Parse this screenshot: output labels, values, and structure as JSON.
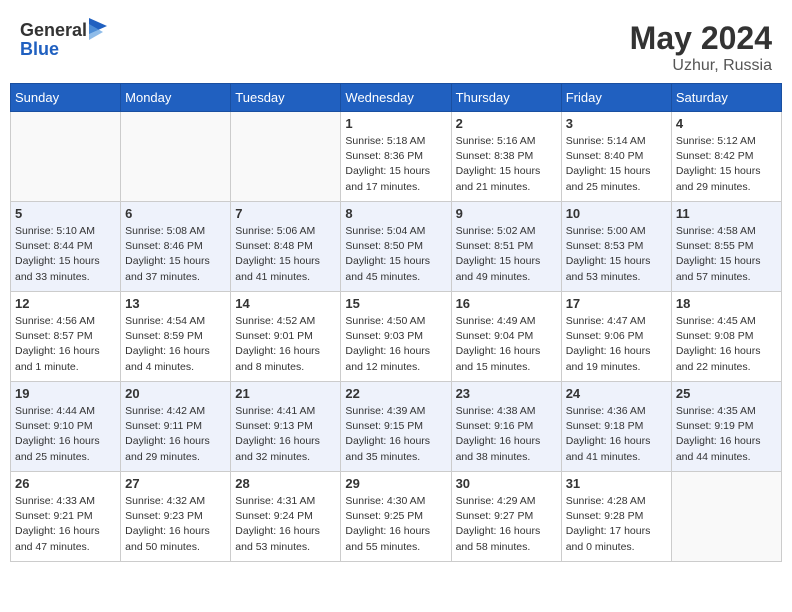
{
  "header": {
    "logo_general": "General",
    "logo_blue": "Blue",
    "month_year": "May 2024",
    "location": "Uzhur, Russia"
  },
  "days_of_week": [
    "Sunday",
    "Monday",
    "Tuesday",
    "Wednesday",
    "Thursday",
    "Friday",
    "Saturday"
  ],
  "weeks": [
    [
      {
        "day": "",
        "info": ""
      },
      {
        "day": "",
        "info": ""
      },
      {
        "day": "",
        "info": ""
      },
      {
        "day": "1",
        "info": "Sunrise: 5:18 AM\nSunset: 8:36 PM\nDaylight: 15 hours\nand 17 minutes."
      },
      {
        "day": "2",
        "info": "Sunrise: 5:16 AM\nSunset: 8:38 PM\nDaylight: 15 hours\nand 21 minutes."
      },
      {
        "day": "3",
        "info": "Sunrise: 5:14 AM\nSunset: 8:40 PM\nDaylight: 15 hours\nand 25 minutes."
      },
      {
        "day": "4",
        "info": "Sunrise: 5:12 AM\nSunset: 8:42 PM\nDaylight: 15 hours\nand 29 minutes."
      }
    ],
    [
      {
        "day": "5",
        "info": "Sunrise: 5:10 AM\nSunset: 8:44 PM\nDaylight: 15 hours\nand 33 minutes."
      },
      {
        "day": "6",
        "info": "Sunrise: 5:08 AM\nSunset: 8:46 PM\nDaylight: 15 hours\nand 37 minutes."
      },
      {
        "day": "7",
        "info": "Sunrise: 5:06 AM\nSunset: 8:48 PM\nDaylight: 15 hours\nand 41 minutes."
      },
      {
        "day": "8",
        "info": "Sunrise: 5:04 AM\nSunset: 8:50 PM\nDaylight: 15 hours\nand 45 minutes."
      },
      {
        "day": "9",
        "info": "Sunrise: 5:02 AM\nSunset: 8:51 PM\nDaylight: 15 hours\nand 49 minutes."
      },
      {
        "day": "10",
        "info": "Sunrise: 5:00 AM\nSunset: 8:53 PM\nDaylight: 15 hours\nand 53 minutes."
      },
      {
        "day": "11",
        "info": "Sunrise: 4:58 AM\nSunset: 8:55 PM\nDaylight: 15 hours\nand 57 minutes."
      }
    ],
    [
      {
        "day": "12",
        "info": "Sunrise: 4:56 AM\nSunset: 8:57 PM\nDaylight: 16 hours\nand 1 minute."
      },
      {
        "day": "13",
        "info": "Sunrise: 4:54 AM\nSunset: 8:59 PM\nDaylight: 16 hours\nand 4 minutes."
      },
      {
        "day": "14",
        "info": "Sunrise: 4:52 AM\nSunset: 9:01 PM\nDaylight: 16 hours\nand 8 minutes."
      },
      {
        "day": "15",
        "info": "Sunrise: 4:50 AM\nSunset: 9:03 PM\nDaylight: 16 hours\nand 12 minutes."
      },
      {
        "day": "16",
        "info": "Sunrise: 4:49 AM\nSunset: 9:04 PM\nDaylight: 16 hours\nand 15 minutes."
      },
      {
        "day": "17",
        "info": "Sunrise: 4:47 AM\nSunset: 9:06 PM\nDaylight: 16 hours\nand 19 minutes."
      },
      {
        "day": "18",
        "info": "Sunrise: 4:45 AM\nSunset: 9:08 PM\nDaylight: 16 hours\nand 22 minutes."
      }
    ],
    [
      {
        "day": "19",
        "info": "Sunrise: 4:44 AM\nSunset: 9:10 PM\nDaylight: 16 hours\nand 25 minutes."
      },
      {
        "day": "20",
        "info": "Sunrise: 4:42 AM\nSunset: 9:11 PM\nDaylight: 16 hours\nand 29 minutes."
      },
      {
        "day": "21",
        "info": "Sunrise: 4:41 AM\nSunset: 9:13 PM\nDaylight: 16 hours\nand 32 minutes."
      },
      {
        "day": "22",
        "info": "Sunrise: 4:39 AM\nSunset: 9:15 PM\nDaylight: 16 hours\nand 35 minutes."
      },
      {
        "day": "23",
        "info": "Sunrise: 4:38 AM\nSunset: 9:16 PM\nDaylight: 16 hours\nand 38 minutes."
      },
      {
        "day": "24",
        "info": "Sunrise: 4:36 AM\nSunset: 9:18 PM\nDaylight: 16 hours\nand 41 minutes."
      },
      {
        "day": "25",
        "info": "Sunrise: 4:35 AM\nSunset: 9:19 PM\nDaylight: 16 hours\nand 44 minutes."
      }
    ],
    [
      {
        "day": "26",
        "info": "Sunrise: 4:33 AM\nSunset: 9:21 PM\nDaylight: 16 hours\nand 47 minutes."
      },
      {
        "day": "27",
        "info": "Sunrise: 4:32 AM\nSunset: 9:23 PM\nDaylight: 16 hours\nand 50 minutes."
      },
      {
        "day": "28",
        "info": "Sunrise: 4:31 AM\nSunset: 9:24 PM\nDaylight: 16 hours\nand 53 minutes."
      },
      {
        "day": "29",
        "info": "Sunrise: 4:30 AM\nSunset: 9:25 PM\nDaylight: 16 hours\nand 55 minutes."
      },
      {
        "day": "30",
        "info": "Sunrise: 4:29 AM\nSunset: 9:27 PM\nDaylight: 16 hours\nand 58 minutes."
      },
      {
        "day": "31",
        "info": "Sunrise: 4:28 AM\nSunset: 9:28 PM\nDaylight: 17 hours\nand 0 minutes."
      },
      {
        "day": "",
        "info": ""
      }
    ]
  ]
}
